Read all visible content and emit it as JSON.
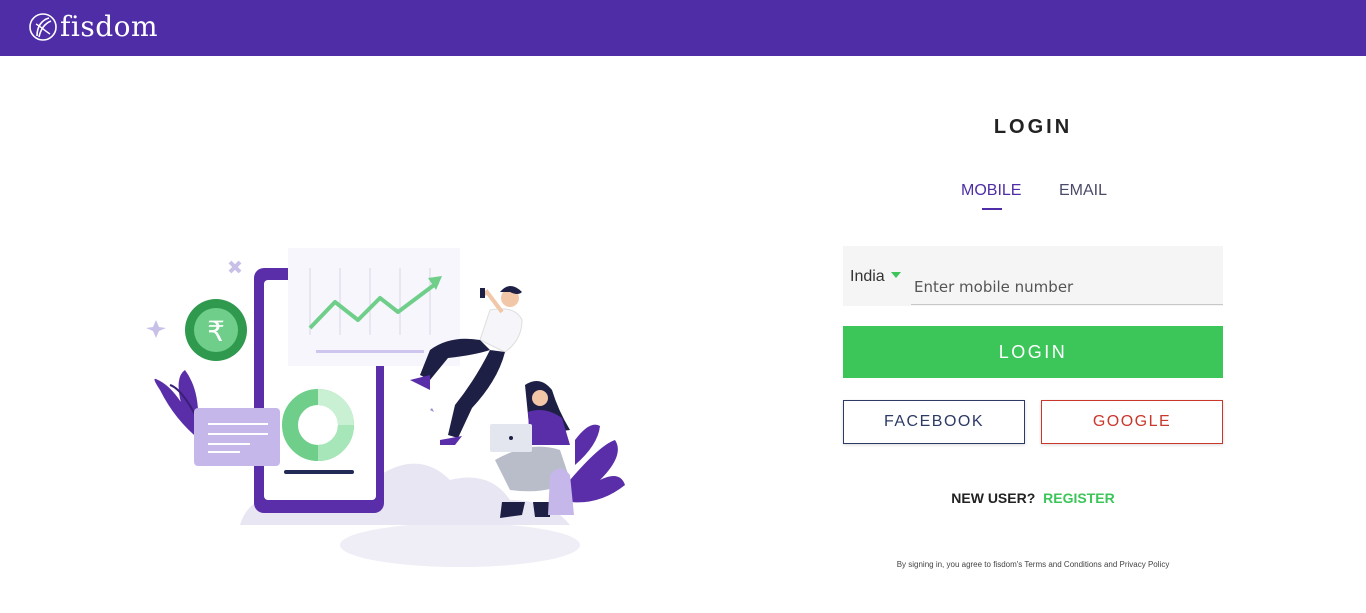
{
  "header": {
    "logo_text": "fisdom",
    "brand_color": "#4f2da7"
  },
  "login": {
    "title": "LOGIN",
    "tabs": [
      {
        "label": "MOBILE",
        "active": true
      },
      {
        "label": "EMAIL",
        "active": false
      }
    ],
    "country": "India",
    "mobile_placeholder": "Enter mobile number",
    "login_button": "LOGIN",
    "facebook_button": "FACEBOOK",
    "google_button": "GOOGLE",
    "new_user_text": "NEW USER?",
    "register_link": "REGISTER",
    "terms_text": "By signing in, you agree to fisdom's Terms and Conditions and Privacy Policy",
    "accent_color": "#3cc65a"
  },
  "illustration": {
    "rupee_symbol": "₹"
  }
}
